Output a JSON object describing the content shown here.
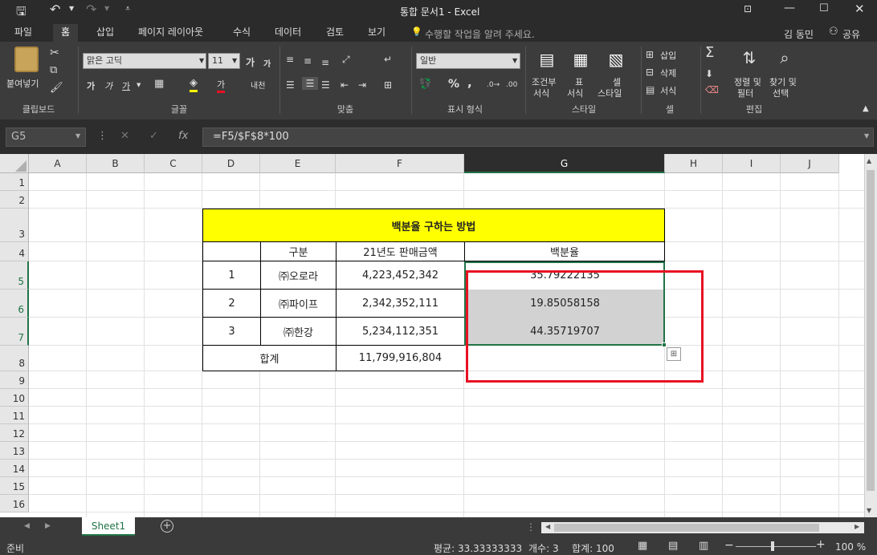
{
  "window": {
    "title": "통합 문서1 - Excel"
  },
  "tabs": [
    "파일",
    "홈",
    "삽입",
    "페이지 레이아웃",
    "수식",
    "데이터",
    "검토",
    "보기"
  ],
  "active_tab": "홈",
  "tell_me": "수행할 작업을 알려 주세요.",
  "user": "김 동민",
  "share": "공유",
  "ribbon": {
    "clipboard": {
      "paste": "붙여넣기",
      "group": "클립보드"
    },
    "font": {
      "name": "맑은 고딕",
      "size": "11",
      "group": "글꼴",
      "grow": "가",
      "shrink": "가",
      "bold": "가",
      "italic": "가",
      "underline": "가",
      "fontcolor": "가",
      "phonetic": "내천"
    },
    "alignment": {
      "group": "맞춤"
    },
    "number": {
      "format": "일반",
      "group": "표시 형식",
      "percent": "%",
      "comma": ","
    },
    "styles": {
      "conditional": [
        "조건부",
        "서식"
      ],
      "table": [
        "표",
        "서식"
      ],
      "cell": [
        "셀",
        "스타일"
      ],
      "group": "스타일"
    },
    "cells": {
      "insert": "삽입",
      "delete": "삭제",
      "format": "서식",
      "group": "셀"
    },
    "editing": {
      "sort": [
        "정렬 및",
        "필터"
      ],
      "find": [
        "찾기 및",
        "선택"
      ],
      "group": "편집"
    }
  },
  "formula_bar": {
    "name_box": "G5",
    "formula": "=F5/$F$8*100",
    "fx": "fx"
  },
  "columns": [
    "A",
    "B",
    "C",
    "D",
    "E",
    "F",
    "G",
    "H",
    "I",
    "J"
  ],
  "rows": [
    "1",
    "2",
    "3",
    "4",
    "5",
    "6",
    "7",
    "8",
    "9",
    "10",
    "11",
    "12",
    "13",
    "14",
    "15",
    "16"
  ],
  "table": {
    "title": "백분율 구하는 방법",
    "headers": {
      "category": "구분",
      "sales": "21년도 판매금액",
      "percent": "백분율"
    },
    "data": [
      {
        "no": "1",
        "name": "㈜오로라",
        "sales": "4,223,452,342",
        "pct": "35.79222135"
      },
      {
        "no": "2",
        "name": "㈜파이프",
        "sales": "2,342,352,111",
        "pct": "19.85058158"
      },
      {
        "no": "3",
        "name": "㈜한강",
        "sales": "5,234,112,351",
        "pct": "44.35719707"
      }
    ],
    "total_label": "합계",
    "total_value": "11,799,916,804"
  },
  "sheet_tab": "Sheet1",
  "status": {
    "ready": "준비",
    "average": "평균: 33.33333333",
    "count": "개수: 3",
    "sum": "합계: 100",
    "zoom": "100 %"
  },
  "colors": {
    "title_fill": "#ffff00",
    "selection_fill": "#d2d2d2",
    "highlight_box": "#e81123",
    "accent": "#217346"
  }
}
